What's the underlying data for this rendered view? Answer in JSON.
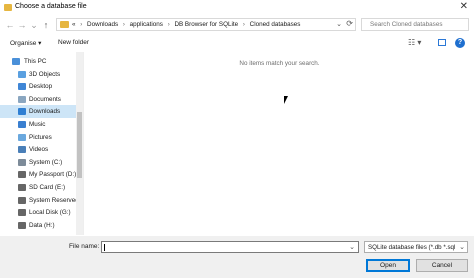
{
  "window": {
    "title": "Choose a database file",
    "close_glyph": "✕"
  },
  "nav": {
    "back": "←",
    "forward": "→",
    "recent": "⌄",
    "up": "↑"
  },
  "address": {
    "overflow": "«",
    "crumbs": [
      "Downloads",
      "applications",
      "DB Browser for SQLite",
      "Cloned databases"
    ],
    "separator": "›"
  },
  "search": {
    "placeholder": "Search Cloned databases"
  },
  "toolbar": {
    "organise": "Organise ▾",
    "new_folder": "New folder",
    "view_glyph": "☷ ▾",
    "help": "?"
  },
  "sidebar": {
    "items": [
      {
        "label": "This PC",
        "icon": "pc-icon",
        "color": "#4a90d9",
        "indent": 0
      },
      {
        "label": "3D Objects",
        "icon": "cube-icon",
        "color": "#5aa0e0",
        "indent": 1
      },
      {
        "label": "Desktop",
        "icon": "desktop-icon",
        "color": "#3f86d6",
        "indent": 1
      },
      {
        "label": "Documents",
        "icon": "documents-icon",
        "color": "#8aa6c0",
        "indent": 1
      },
      {
        "label": "Downloads",
        "icon": "downloads-icon",
        "color": "#2f7fd3",
        "indent": 1,
        "selected": true
      },
      {
        "label": "Music",
        "icon": "music-icon",
        "color": "#3a7fd0",
        "indent": 1
      },
      {
        "label": "Pictures",
        "icon": "pictures-icon",
        "color": "#6aa8de",
        "indent": 1
      },
      {
        "label": "Videos",
        "icon": "videos-icon",
        "color": "#4a7fb8",
        "indent": 1
      },
      {
        "label": "System (C:)",
        "icon": "drive-icon",
        "color": "#7d8b99",
        "indent": 1
      },
      {
        "label": "My Passport (D:)",
        "icon": "drive-icon",
        "color": "#666666",
        "indent": 1
      },
      {
        "label": "SD Card (E:)",
        "icon": "drive-icon",
        "color": "#666666",
        "indent": 1
      },
      {
        "label": "System Reserved",
        "icon": "drive-icon",
        "color": "#666666",
        "indent": 1
      },
      {
        "label": "Local Disk (G:)",
        "icon": "drive-icon",
        "color": "#666666",
        "indent": 1
      },
      {
        "label": "Data (H:)",
        "icon": "drive-icon",
        "color": "#666666",
        "indent": 1
      }
    ]
  },
  "content": {
    "empty_message": "No items match your search."
  },
  "footer": {
    "file_name_label": "File name:",
    "file_name_value": "",
    "filter": "SQLite database files (*.db *.sql",
    "open": "Open",
    "cancel": "Cancel"
  }
}
